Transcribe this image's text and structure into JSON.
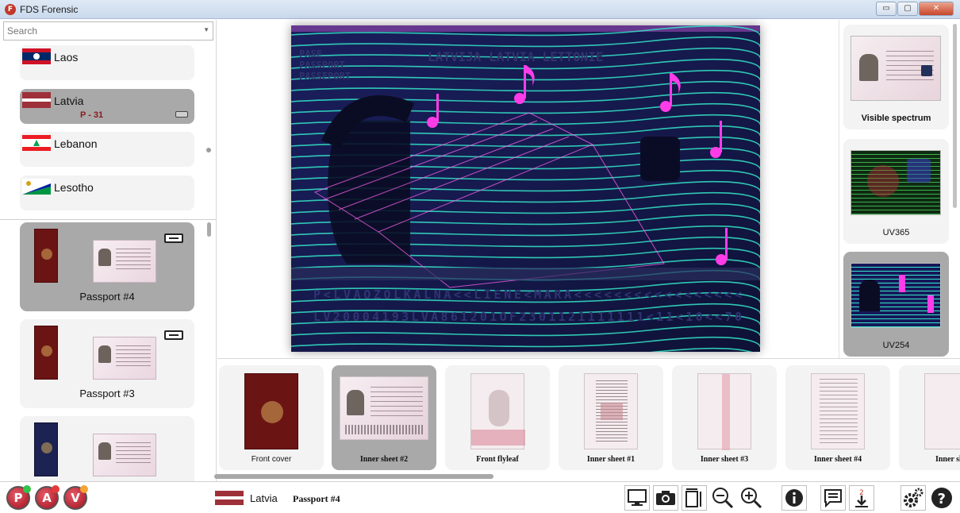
{
  "app": {
    "title": "FDS Forensic",
    "icon_letter": "F"
  },
  "window_controls": {
    "minimize": "▭",
    "maximize": "▢",
    "close": "✕"
  },
  "search": {
    "placeholder": "Search"
  },
  "countries": [
    {
      "name": "Laos",
      "code": "",
      "selected": false
    },
    {
      "name": "Latvia",
      "code": "P - 31",
      "selected": true
    },
    {
      "name": "Lebanon",
      "code": "",
      "selected": false
    },
    {
      "name": "Lesotho",
      "code": "",
      "selected": false
    }
  ],
  "documents": [
    {
      "label": "Passport #4",
      "selected": true,
      "cover_color": "red"
    },
    {
      "label": "Passport #3",
      "selected": false,
      "cover_color": "red"
    },
    {
      "label": "",
      "selected": false,
      "cover_color": "blue"
    }
  ],
  "viewer": {
    "mrz_line1": "P<LVAOZOLKALNA<<LIENE<MARA<<<<<<<<<<<<<<<<<",
    "mrz_line2": "LV20004193LVA861201OF2301121111111<11<10<<70",
    "header_text": "LATVIJA  LATVIA  LETTONIE",
    "side_text": [
      "PASE",
      "PASSPORT",
      "PASSEPORT"
    ]
  },
  "spectra": [
    {
      "label": "Visible spectrum",
      "selected": false,
      "bold": true
    },
    {
      "label": "UV365",
      "selected": false,
      "bold": false
    },
    {
      "label": "UV254",
      "selected": true,
      "bold": false
    }
  ],
  "pages": [
    {
      "label": "Front cover",
      "selected": false,
      "bold": false
    },
    {
      "label": "Inner sheet #2",
      "selected": true,
      "bold": true
    },
    {
      "label": "Front flyleaf",
      "selected": false,
      "bold": true
    },
    {
      "label": "Inner sheet #1",
      "selected": false,
      "bold": true
    },
    {
      "label": "Inner sheet #3",
      "selected": false,
      "bold": true
    },
    {
      "label": "Inner sheet #4",
      "selected": false,
      "bold": true
    },
    {
      "label": "Inner she",
      "selected": false,
      "bold": true
    }
  ],
  "status": {
    "country": "Latvia",
    "document": "Passport #4"
  },
  "modes": [
    {
      "letter": "P",
      "dot_color": "#34c24a"
    },
    {
      "letter": "A",
      "dot_color": "#e33b3b"
    },
    {
      "letter": "V",
      "dot_color": "#f2a531"
    }
  ],
  "toolbar_icons": [
    "monitor-icon",
    "camera-icon",
    "fit-size-icon",
    "zoom-out-icon",
    "zoom-in-icon",
    "info-icon",
    "comment-icon",
    "download-icon",
    "settings-icon",
    "help-icon"
  ],
  "colors": {
    "selected_card": "#a9a9a9",
    "card": "#f3f3f3",
    "uv_background": "#13174a",
    "uv_glow": "#35e6c8",
    "uv_magenta": "#ff3ce8"
  }
}
